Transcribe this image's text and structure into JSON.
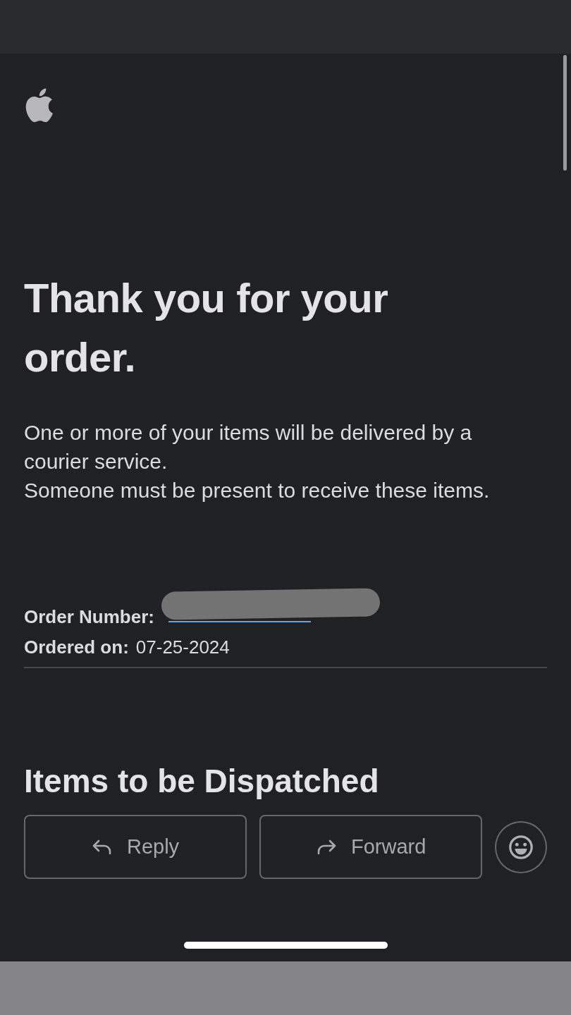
{
  "email": {
    "title": "Thank you for your order.",
    "paragraphs": [
      "One or more of your items will be delivered by a courier service.",
      "Someone must be present to receive these items."
    ],
    "details": [
      {
        "kind": "redacted",
        "label": "Order Number:"
      },
      {
        "kind": "text",
        "label": "Ordered on:",
        "value": "07-25-2024"
      }
    ],
    "section_heading": "Items to be Dispatched"
  },
  "actions": [
    {
      "kind": "reply",
      "label": "Reply"
    },
    {
      "kind": "forward",
      "label": "Forward"
    },
    {
      "kind": "emoji"
    }
  ]
}
